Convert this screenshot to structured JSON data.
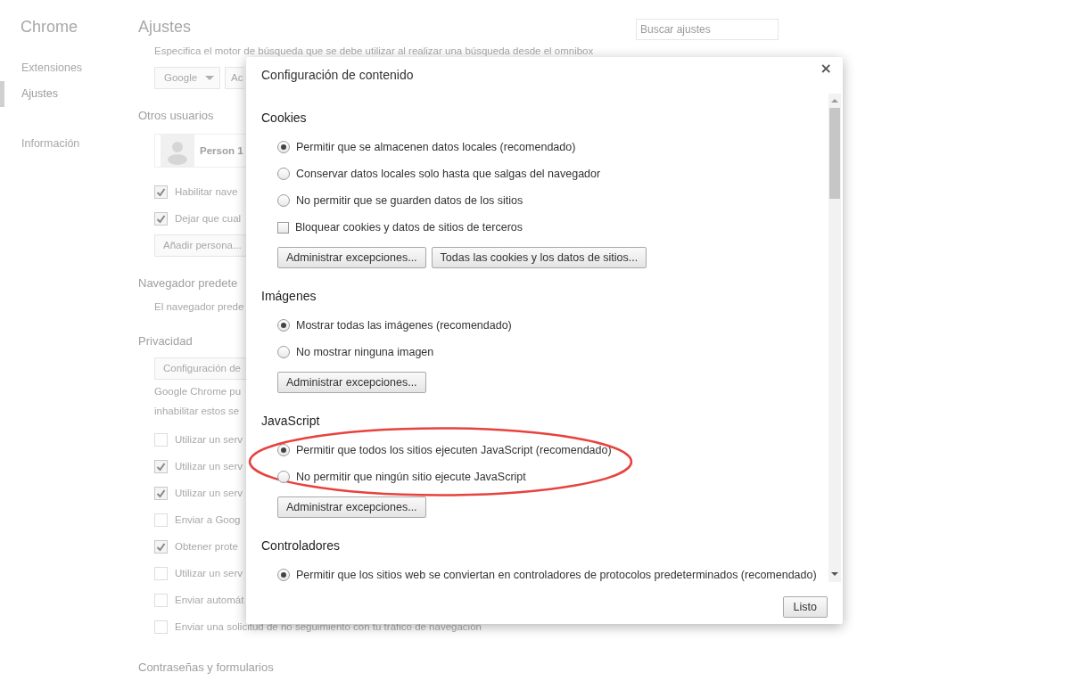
{
  "sidebar": {
    "title": "Chrome",
    "items": [
      {
        "label": "Extensiones",
        "selected": false
      },
      {
        "label": "Ajustes",
        "selected": true
      },
      {
        "label": "Información",
        "selected": false
      }
    ]
  },
  "settings": {
    "title": "Ajustes",
    "search": {
      "placeholder": "Buscar ajustes"
    },
    "rows": [
      {
        "kind": "text",
        "text": "Especifica el motor de búsqueda que se debe utilizar al realizar una búsqueda desde el omnibox"
      },
      {
        "kind": "engine",
        "dropdown": "Google",
        "button": "Ac"
      },
      {
        "kind": "heading",
        "text": "Otros usuarios"
      },
      {
        "kind": "user",
        "text": "Person 1"
      },
      {
        "kind": "checkbox",
        "text": "Habilitar nave",
        "checked": true
      },
      {
        "kind": "checkbox",
        "text": "Dejar que cual",
        "checked": true
      },
      {
        "kind": "button",
        "text": "Añadir persona..."
      },
      {
        "kind": "heading",
        "text": "Navegador predete"
      },
      {
        "kind": "text",
        "text": "El navegador prede"
      },
      {
        "kind": "heading",
        "text": "Privacidad"
      },
      {
        "kind": "button",
        "text": "Configuración de"
      },
      {
        "kind": "text",
        "text": "Google Chrome pu"
      },
      {
        "kind": "text",
        "text": "inhabilitar estos se"
      },
      {
        "kind": "checkbox",
        "text": "Utilizar un serv",
        "checked": false
      },
      {
        "kind": "checkbox",
        "text": "Utilizar un serv",
        "checked": true
      },
      {
        "kind": "checkbox",
        "text": "Utilizar un serv",
        "checked": true
      },
      {
        "kind": "checkbox",
        "text": "Enviar a Goog",
        "checked": false
      },
      {
        "kind": "checkbox",
        "text": "Obtener prote",
        "checked": true
      },
      {
        "kind": "checkbox",
        "text": "Utilizar un serv",
        "checked": false
      },
      {
        "kind": "checkbox",
        "text": "Enviar automát",
        "checked": false
      },
      {
        "kind": "checkbox",
        "text": "Enviar una solicitud de no seguimiento con tu tráfico de navegación",
        "checked": false
      },
      {
        "kind": "heading",
        "text": "Contraseñas y formularios"
      }
    ]
  },
  "dialog": {
    "title": "Configuración de contenido",
    "close": "×",
    "sections": [
      {
        "title": "Cookies",
        "options": [
          {
            "kind": "radio",
            "label": "Permitir que se almacenen datos locales (recomendado)",
            "selected": true
          },
          {
            "kind": "radio",
            "label": "Conservar datos locales solo hasta que salgas del navegador",
            "selected": false
          },
          {
            "kind": "radio",
            "label": "No permitir que se guarden datos de los sitios",
            "selected": false
          },
          {
            "kind": "checkbox",
            "label": "Bloquear cookies y datos de sitios de terceros",
            "checked": false
          }
        ],
        "buttons": [
          "Administrar excepciones...",
          "Todas las cookies y los datos de sitios..."
        ]
      },
      {
        "title": "Imágenes",
        "options": [
          {
            "kind": "radio",
            "label": "Mostrar todas las imágenes (recomendado)",
            "selected": true
          },
          {
            "kind": "radio",
            "label": "No mostrar ninguna imagen",
            "selected": false
          }
        ],
        "buttons": [
          "Administrar excepciones..."
        ]
      },
      {
        "title": "JavaScript",
        "options": [
          {
            "kind": "radio",
            "label": "Permitir que todos los sitios ejecuten JavaScript (recomendado)",
            "selected": true
          },
          {
            "kind": "radio",
            "label": "No permitir que ningún sitio ejecute JavaScript",
            "selected": false
          }
        ],
        "buttons": [
          "Administrar excepciones..."
        ]
      },
      {
        "title": "Controladores",
        "options": [
          {
            "kind": "radio",
            "label": "Permitir que los sitios web se conviertan en controladores de protocolos predeterminados (recomendado)",
            "selected": true
          }
        ]
      }
    ],
    "done_button": "Listo"
  }
}
